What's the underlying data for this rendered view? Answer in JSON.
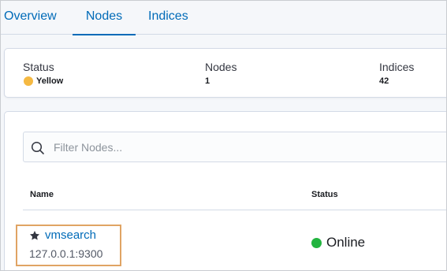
{
  "tabs": [
    {
      "label": "Overview"
    },
    {
      "label": "Nodes",
      "active": true
    },
    {
      "label": "Indices"
    }
  ],
  "summary": {
    "status_label": "Status",
    "status_value": "Yellow",
    "status_color": "#f5b942",
    "nodes_label": "Nodes",
    "nodes_value": "1",
    "indices_label": "Indices",
    "indices_value": "42"
  },
  "search": {
    "placeholder": "Filter Nodes...",
    "value": "",
    "icon": "search-icon"
  },
  "table": {
    "columns": [
      "Name",
      "Status"
    ],
    "rows": [
      {
        "name": "vmsearch",
        "name_icon": "star-icon",
        "address": "127.0.0.1:9300",
        "status": "Online",
        "status_color": "#22b43f"
      }
    ]
  },
  "colors": {
    "accent": "#006bb8",
    "highlight_border": "#e0a464"
  }
}
